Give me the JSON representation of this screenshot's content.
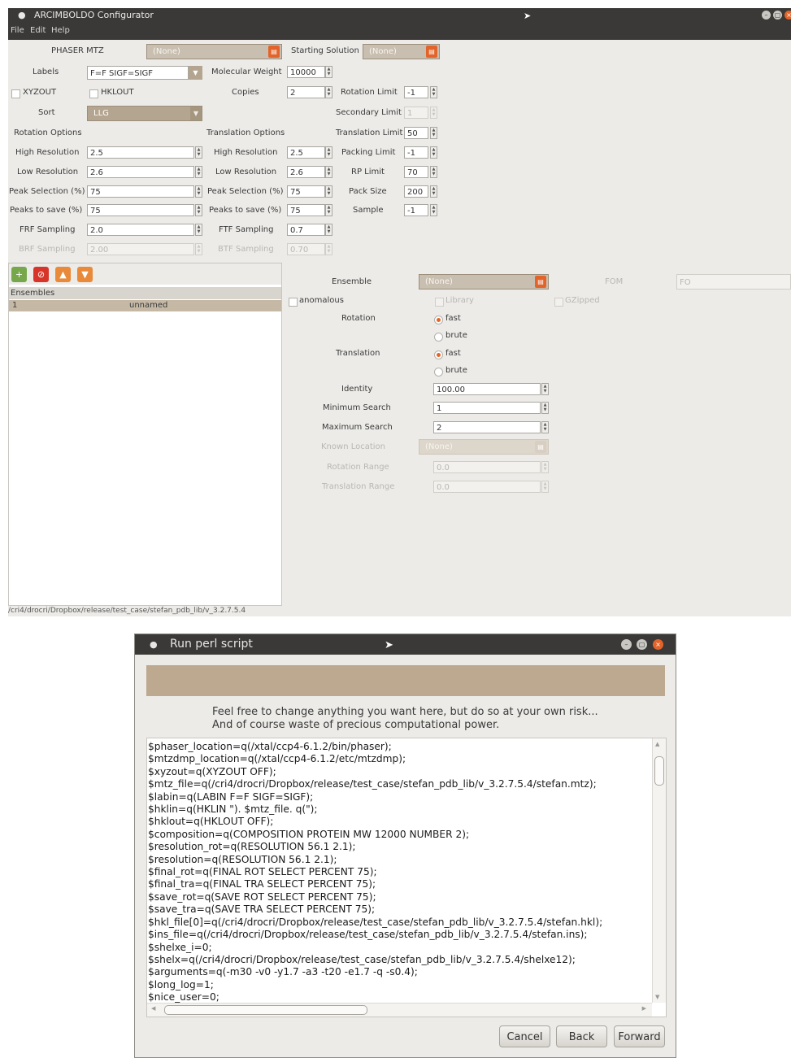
{
  "main_window": {
    "title": "ARCIMBOLDO Configurator",
    "menu": [
      "File",
      "Edit",
      "Help"
    ],
    "phaser_mtz_label": "PHASER MTZ",
    "phaser_mtz_value": "(None)",
    "starting_solution_label": "Starting Solution",
    "starting_solution_value": "(None)",
    "labels_label": "Labels",
    "labels_value": "F=F   SIGF=SIGF",
    "molecular_weight_label": "Molecular Weight",
    "molecular_weight_value": "10000",
    "xyzout_label": "XYZOUT",
    "hklout_label": "HKLOUT",
    "copies_label": "Copies",
    "copies_value": "2",
    "rotation_limit_label": "Rotation Limit",
    "rotation_limit_value": "-1",
    "sort_label": "Sort",
    "sort_value": "LLG",
    "secondary_limit_label": "Secondary Limit",
    "secondary_limit_value": "1",
    "rotation_options_label": "Rotation Options",
    "translation_options_label": "Translation Options",
    "translation_limit_label": "Translation Limit",
    "translation_limit_value": "50",
    "rot_high_res_label": "High Resolution",
    "rot_high_res_value": "2.5",
    "tra_high_res_label": "High Resolution",
    "tra_high_res_value": "2.5",
    "packing_limit_label": "Packing Limit",
    "packing_limit_value": "-1",
    "rot_low_res_label": "Low Resolution",
    "rot_low_res_value": "2.6",
    "tra_low_res_label": "Low Resolution",
    "tra_low_res_value": "2.6",
    "rp_limit_label": "RP Limit",
    "rp_limit_value": "70",
    "rot_peak_sel_label": "Peak Selection (%)",
    "rot_peak_sel_value": "75",
    "tra_peak_sel_label": "Peak Selection (%)",
    "tra_peak_sel_value": "75",
    "pack_size_label": "Pack Size",
    "pack_size_value": "200",
    "rot_peaks_save_label": "Peaks to save (%)",
    "rot_peaks_save_value": "75",
    "tra_peaks_save_label": "Peaks to save (%)",
    "tra_peaks_save_value": "75",
    "sample_label": "Sample",
    "sample_value": "-1",
    "frf_sampling_label": "FRF Sampling",
    "frf_sampling_value": "2.0",
    "ftf_sampling_label": "FTF Sampling",
    "ftf_sampling_value": "0.7",
    "brf_sampling_label": "BRF Sampling",
    "brf_sampling_value": "2.00",
    "btf_sampling_label": "BTF Sampling",
    "btf_sampling_value": "0.70",
    "ensembles_header": "Ensembles",
    "ensemble_row_index": "1",
    "ensemble_row_name": "unnamed",
    "ensemble_label": "Ensemble",
    "ensemble_value": "(None)",
    "fom_label": "FOM",
    "fom_value": "FO",
    "anomalous_label": "anomalous",
    "library_label": "Library",
    "gzipped_label": "GZipped",
    "rotation_label": "Rotation",
    "rotation_fast": "fast",
    "rotation_brute": "brute",
    "translation_label": "Translation",
    "translation_fast": "fast",
    "translation_brute": "brute",
    "identity_label": "Identity",
    "identity_value": "100.00",
    "min_search_label": "Minimum Search",
    "min_search_value": "1",
    "max_search_label": "Maximum Search",
    "max_search_value": "2",
    "known_location_label": "Known Location",
    "known_location_value": "(None)",
    "rotation_range_label": "Rotation Range",
    "rotation_range_value": "0.0",
    "translation_range_label": "Translation Range",
    "translation_range_value": "0.0",
    "status_path": "/cri4/drocri/Dropbox/release/test_case/stefan_pdb_lib/v_3.2.7.5.4"
  },
  "dialog": {
    "title": "Run perl script",
    "note_line1": "Feel free to change anything you want here, but do so at your own risk...",
    "note_line2": "And of course waste of precious computational power.",
    "script": "$phaser_location=q(/xtal/ccp4-6.1.2/bin/phaser);\n$mtzdmp_location=q(/xtal/ccp4-6.1.2/etc/mtzdmp);\n$xyzout=q(XYZOUT OFF);\n$mtz_file=q(/cri4/drocri/Dropbox/release/test_case/stefan_pdb_lib/v_3.2.7.5.4/stefan.mtz);\n$labin=q(LABIN F=F SIGF=SIGF);\n$hklin=q(HKLIN \"). $mtz_file. q(\");\n$hklout=q(HKLOUT OFF);\n$composition=q(COMPOSITION PROTEIN MW 12000 NUMBER 2);\n$resolution_rot=q(RESOLUTION 56.1 2.1);\n$resolution=q(RESOLUTION 56.1 2.1);\n$final_rot=q(FINAL ROT SELECT PERCENT 75);\n$final_tra=q(FINAL TRA SELECT PERCENT 75);\n$save_rot=q(SAVE ROT SELECT PERCENT 75);\n$save_tra=q(SAVE TRA SELECT PERCENT 75);\n$hkl_file[0]=q(/cri4/drocri/Dropbox/release/test_case/stefan_pdb_lib/v_3.2.7.5.4/stefan.hkl);\n$ins_file=q(/cri4/drocri/Dropbox/release/test_case/stefan_pdb_lib/v_3.2.7.5.4/stefan.ins);\n$shelxe_i=0;\n$shelx=q(/cri4/drocri/Dropbox/release/test_case/stefan_pdb_lib/v_3.2.7.5.4/shelxe12);\n$arguments=q(-m30 -v0 -y1.7 -a3 -t20 -e1.7 -q -s0.4);\n$long_log=1;\n$nice_user=0;",
    "cancel_label": "Cancel",
    "back_label": "Back",
    "forward_label": "Forward"
  },
  "icons": {
    "add": "add-icon",
    "remove": "remove-icon",
    "up": "up-icon",
    "down": "down-icon",
    "open_file": "folder-open-icon"
  },
  "colors": {
    "accent": "#e3642a",
    "combo": "#b4a590",
    "titlebar": "#3a3937",
    "banner": "#bca98f"
  }
}
